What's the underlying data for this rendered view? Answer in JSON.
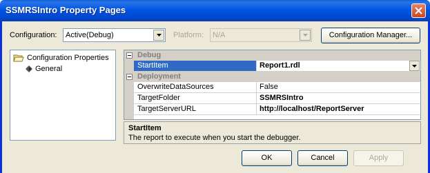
{
  "window": {
    "title": "SSMRSIntro Property Pages"
  },
  "toolbar": {
    "configuration_label": "Configuration:",
    "configuration_value": "Active(Debug)",
    "platform_label": "Platform:",
    "platform_value": "N/A",
    "config_manager_label": "Configuration Manager..."
  },
  "tree": {
    "root_label": "Configuration Properties",
    "child_label": "General"
  },
  "grid": {
    "categories": [
      {
        "label": "Debug"
      },
      {
        "label": "Deployment"
      }
    ],
    "rows": [
      {
        "name": "StartItem",
        "value": "Report1.rdl"
      },
      {
        "name": "OverwriteDataSources",
        "value": "False"
      },
      {
        "name": "TargetFolder",
        "value": "SSMRSIntro"
      },
      {
        "name": "TargetServerURL",
        "value": "http://localhost/ReportServer"
      }
    ]
  },
  "description": {
    "title": "StartItem",
    "text": "The report to execute when you start the debugger."
  },
  "buttons": {
    "ok": "OK",
    "cancel": "Cancel",
    "apply": "Apply"
  }
}
